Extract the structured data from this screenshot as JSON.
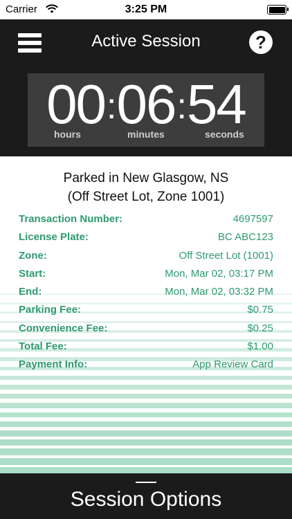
{
  "status_bar": {
    "carrier": "Carrier",
    "time": "3:25 PM"
  },
  "header": {
    "title": "Active Session",
    "menu_icon": "hamburger-menu-icon",
    "help_icon": "question-mark-icon"
  },
  "timer": {
    "hours": "00",
    "minutes": "06",
    "seconds": "54",
    "hours_label": "hours",
    "minutes_label": "minutes",
    "seconds_label": "seconds"
  },
  "session": {
    "location_line1": "Parked in New Glasgow, NS",
    "location_line2": "(Off Street Lot, Zone 1001)",
    "details": [
      {
        "label": "Transaction Number:",
        "value": "4697597"
      },
      {
        "label": "License Plate:",
        "value": "BC ABC123"
      },
      {
        "label": "Zone:",
        "value": "Off Street Lot (1001)"
      },
      {
        "label": "Start:",
        "value": "Mon, Mar 02, 03:17 PM"
      },
      {
        "label": "End:",
        "value": "Mon, Mar 02, 03:32 PM"
      },
      {
        "label": "Parking Fee:",
        "value": "$0.75"
      },
      {
        "label": "Convenience Fee:",
        "value": "$0.25"
      },
      {
        "label": "Total Fee:",
        "value": "$1.00"
      },
      {
        "label": "Payment Info:",
        "value": "App Review Card"
      }
    ]
  },
  "bottom_bar": {
    "label": "Session Options"
  },
  "colors": {
    "accent": "#2e9a6e",
    "dark": "#1b1b1b",
    "timer_box": "#3d3d3d",
    "stripe": "#a9dcc6"
  }
}
